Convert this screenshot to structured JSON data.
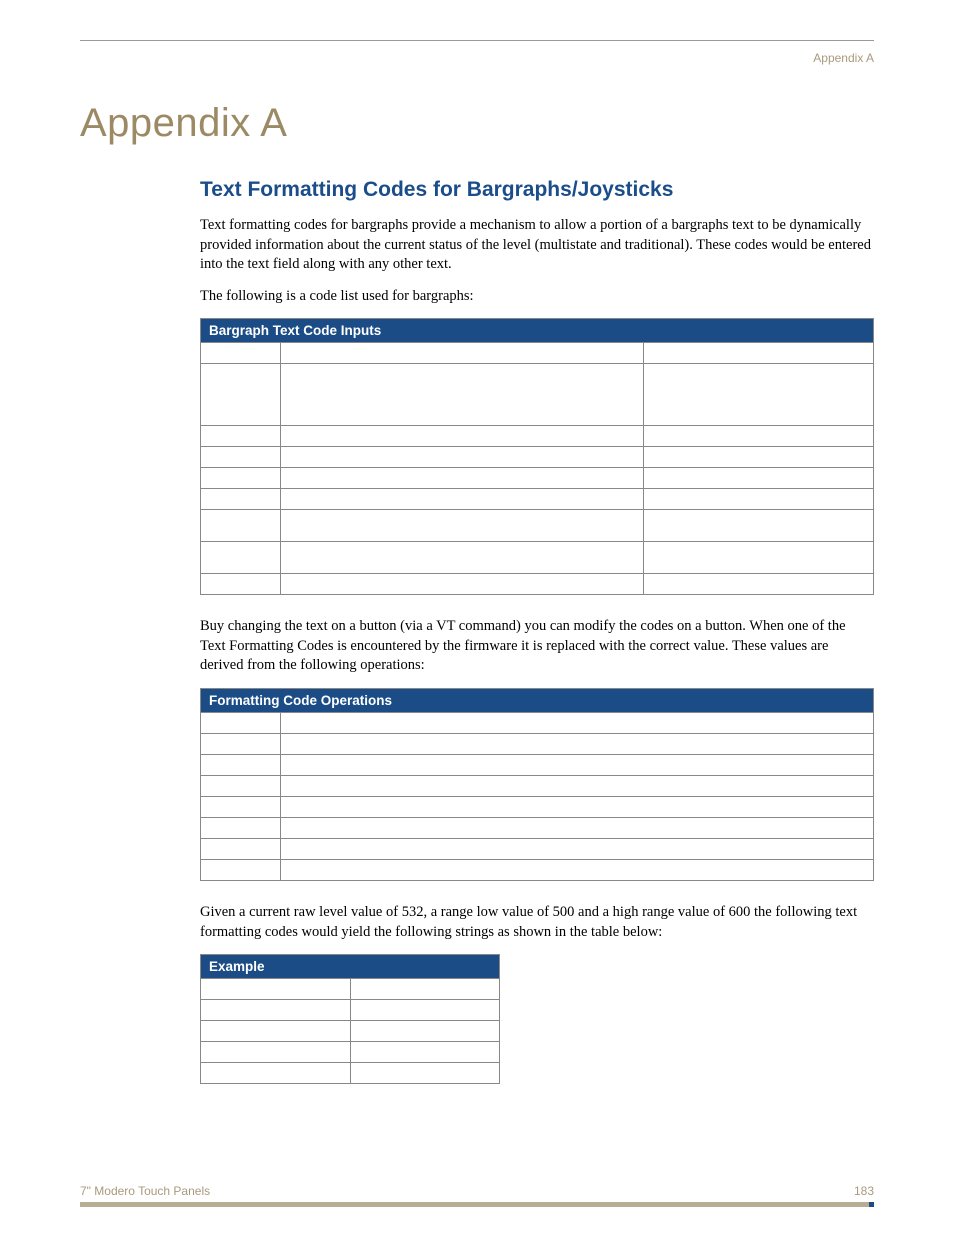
{
  "header": {
    "running_head": "Appendix A"
  },
  "chapter_title": "Appendix A",
  "section_title": "Text Formatting Codes for Bargraphs/Joysticks",
  "paragraphs": {
    "p1": "Text formatting codes for bargraphs provide a mechanism to allow a portion of a bargraphs text to be dynamically provided information about the current status of the level (multistate and traditional). These codes would be entered into the text field along with any other text.",
    "p2": "The following is a code list used for bargraphs:",
    "p3": "Buy changing the text on a button (via a VT command) you can modify the codes on a button. When one of the Text Formatting Codes is encountered by the firmware it is replaced with the correct value. These values are derived from the following operations:",
    "p4": "Given a current raw level value of 532, a range low value of 500 and a high range value of 600 the following text formatting codes would yield the following strings as shown in the table below:"
  },
  "tables": {
    "t1_header": "Bargraph Text Code Inputs",
    "t2_header": "Formatting Code Operations",
    "t3_header": "Example"
  },
  "footer": {
    "doc_title": "7\" Modero Touch Panels",
    "page_number": "183"
  }
}
